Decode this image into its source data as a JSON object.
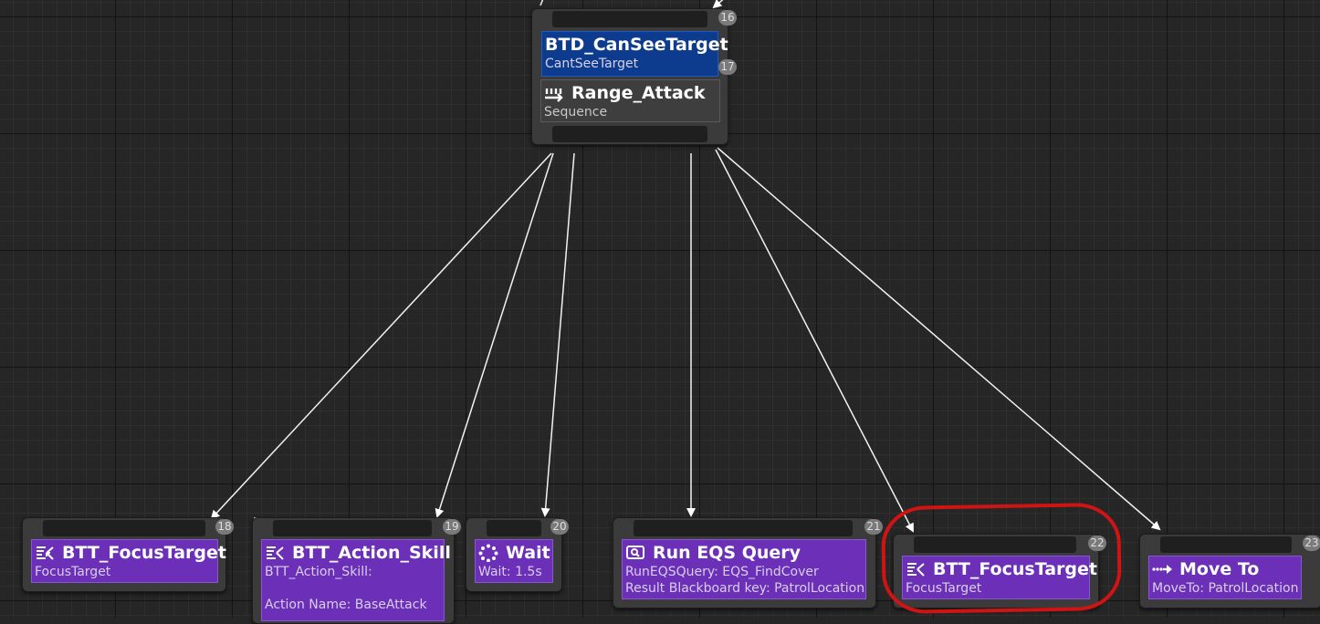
{
  "root": {
    "index": "16",
    "decorator": {
      "title": "BTD_CanSeeTarget",
      "subtitle": "CantSeeTarget",
      "index": "17"
    },
    "composite": {
      "title": "Range_Attack",
      "subtitle": "Sequence",
      "icon": "sequence-icon"
    }
  },
  "tasks": [
    {
      "title": "BTT_FocusTarget",
      "subtitle": "FocusTarget",
      "index": "18",
      "icon": "blueprint-task-icon"
    },
    {
      "title": "BTT_Action_Skill",
      "subtitle": "BTT_Action_Skill:",
      "subtitle2": "Action Name: BaseAttack",
      "index": "19",
      "icon": "blueprint-task-icon"
    },
    {
      "title": "Wait",
      "subtitle": "Wait: 1.5s",
      "index": "20",
      "icon": "wait-icon"
    },
    {
      "title": "Run EQS Query",
      "subtitle": "RunEQSQuery: EQS_FindCover",
      "subtitle2": "Result Blackboard key: PatrolLocation",
      "index": "21",
      "icon": "eqs-query-icon"
    },
    {
      "title": "BTT_FocusTarget",
      "subtitle": "FocusTarget",
      "index": "22",
      "icon": "blueprint-task-icon"
    },
    {
      "title": "Move To",
      "subtitle": "MoveTo: PatrolLocation",
      "index": "23",
      "icon": "move-to-icon"
    }
  ],
  "colors": {
    "task": "#6b2fb8",
    "decorator": "#0d3c8f",
    "highlight": "#d01414",
    "wire": "#ffffff"
  }
}
